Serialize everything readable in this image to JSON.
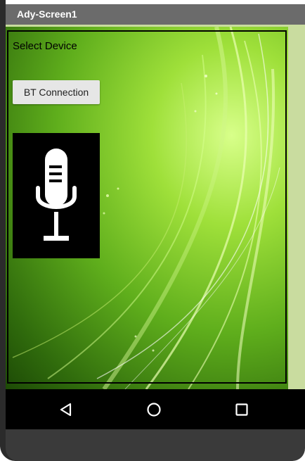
{
  "window": {
    "title": "Ady-Screen1"
  },
  "main": {
    "select_label": "Select Device",
    "bt_button_label": "BT Connection",
    "mic_icon": "microphone-icon"
  },
  "navbar": {
    "icons": [
      "back-triangle-icon",
      "home-circle-icon",
      "recents-square-icon"
    ]
  },
  "colors": {
    "titlebar": "#6b6b6b",
    "button": "#e6e6e6",
    "navbar": "#000000",
    "content_bg": "#c9dc9f"
  }
}
